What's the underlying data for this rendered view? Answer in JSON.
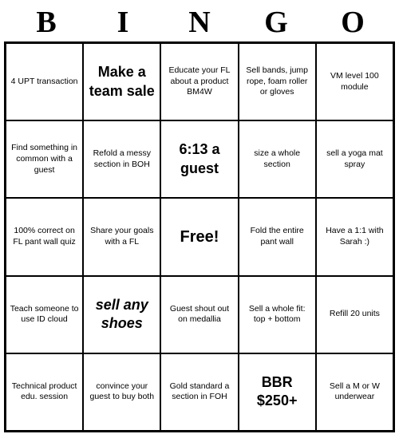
{
  "title": {
    "letters": [
      "B",
      "I",
      "N",
      "G",
      "O"
    ]
  },
  "cells": [
    {
      "text": "4 UPT transaction",
      "style": "normal"
    },
    {
      "text": "Make a team sale",
      "style": "large-text"
    },
    {
      "text": "Educate your FL about a product BM4W",
      "style": "normal"
    },
    {
      "text": "Sell bands, jump rope, foam roller or gloves",
      "style": "normal"
    },
    {
      "text": "VM level 100 module",
      "style": "normal"
    },
    {
      "text": "Find something in common with a guest",
      "style": "normal"
    },
    {
      "text": "Refold a messy section in BOH",
      "style": "normal"
    },
    {
      "text": "6:13 a guest",
      "style": "large-text"
    },
    {
      "text": "size a whole section",
      "style": "normal"
    },
    {
      "text": "sell a yoga mat spray",
      "style": "normal"
    },
    {
      "text": "100% correct on FL pant wall quiz",
      "style": "normal"
    },
    {
      "text": "Share your goals with a FL",
      "style": "normal"
    },
    {
      "text": "Free!",
      "style": "free"
    },
    {
      "text": "Fold the entire pant wall",
      "style": "normal"
    },
    {
      "text": "Have a 1:1 with Sarah :)",
      "style": "normal"
    },
    {
      "text": "Teach someone to use ID cloud",
      "style": "normal"
    },
    {
      "text": "sell any shoes",
      "style": "bold-italic"
    },
    {
      "text": "Guest shout out on medallia",
      "style": "normal"
    },
    {
      "text": "Sell a whole fit: top + bottom",
      "style": "normal"
    },
    {
      "text": "Refill 20 units",
      "style": "normal"
    },
    {
      "text": "Technical product edu. session",
      "style": "normal"
    },
    {
      "text": "convince your guest to buy both",
      "style": "normal"
    },
    {
      "text": "Gold standard a section in FOH",
      "style": "normal"
    },
    {
      "text": "BBR $250+",
      "style": "bbr"
    },
    {
      "text": "Sell a M or W underwear",
      "style": "normal"
    }
  ]
}
